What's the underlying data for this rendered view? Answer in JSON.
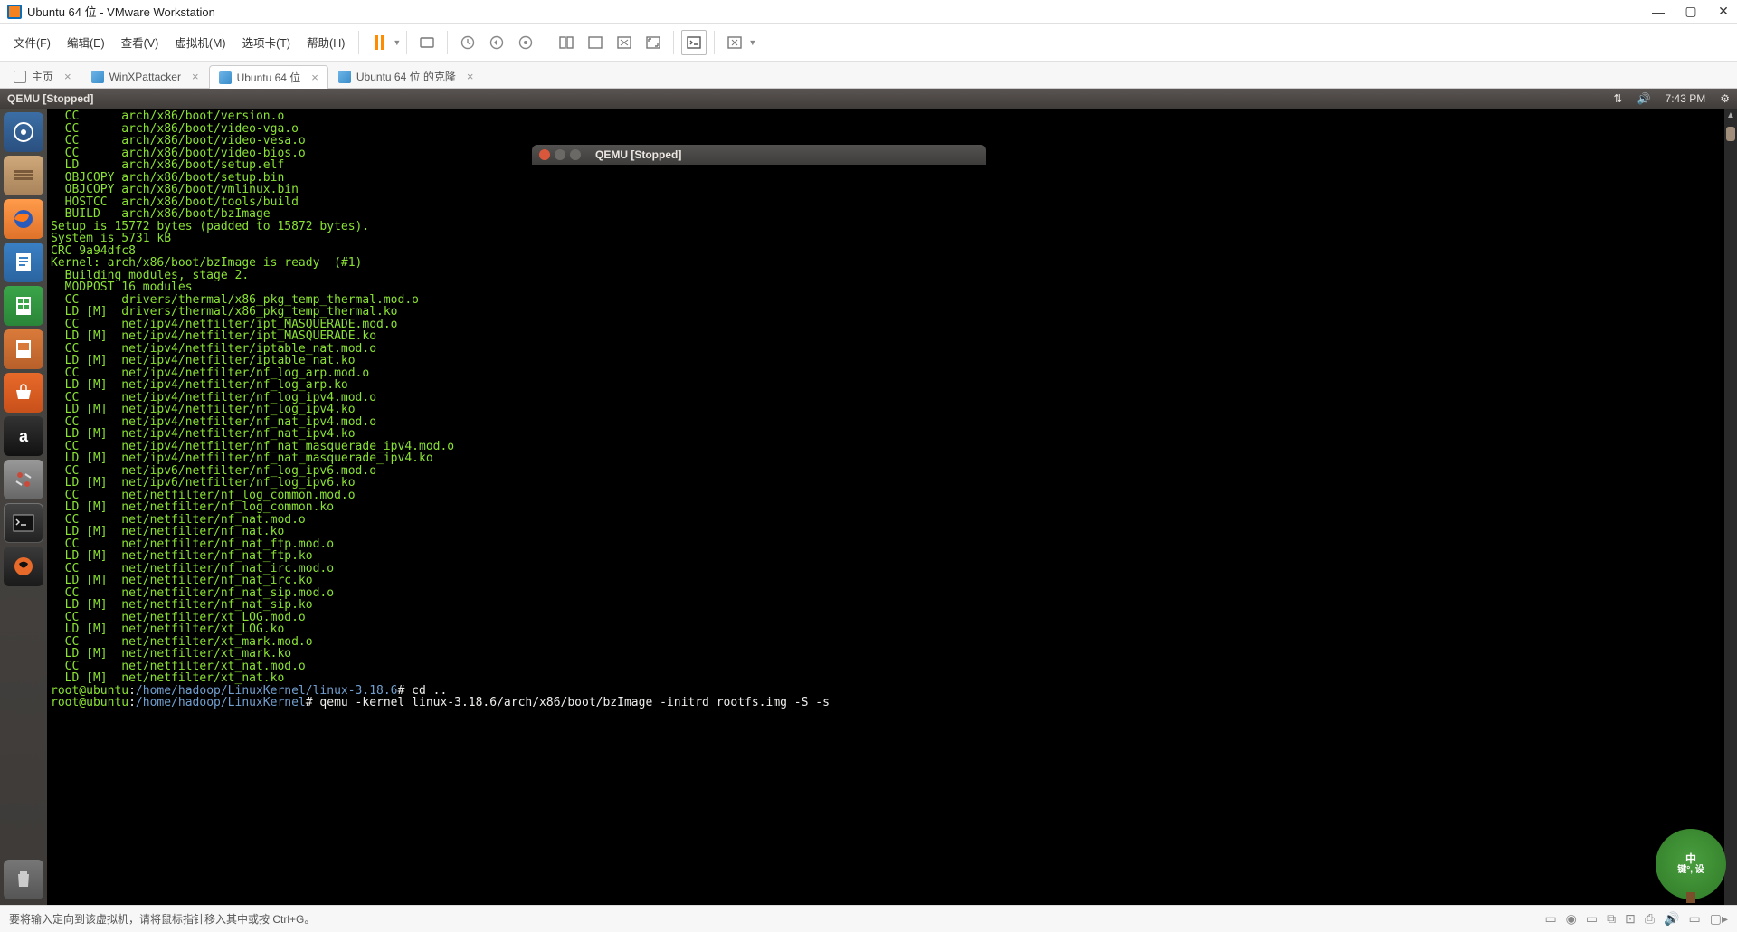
{
  "window": {
    "title": "Ubuntu 64 位 - VMware Workstation"
  },
  "menubar": {
    "items": [
      "文件(F)",
      "编辑(E)",
      "查看(V)",
      "虚拟机(M)",
      "选项卡(T)",
      "帮助(H)"
    ]
  },
  "tabs": [
    {
      "label": "主页",
      "icon": "home",
      "active": false
    },
    {
      "label": "WinXPattacker",
      "icon": "machine",
      "active": false
    },
    {
      "label": "Ubuntu 64 位",
      "icon": "machine",
      "active": true
    },
    {
      "label": "Ubuntu 64 位 的克隆",
      "icon": "machine",
      "active": false
    }
  ],
  "ubuntu_top": {
    "title": "QEMU [Stopped]",
    "time": "7:43 PM"
  },
  "qemu_window": {
    "title": "QEMU [Stopped]"
  },
  "terminal": {
    "lines": [
      "  CC      arch/x86/boot/version.o",
      "  CC      arch/x86/boot/video-vga.o",
      "  CC      arch/x86/boot/video-vesa.o",
      "  CC      arch/x86/boot/video-bios.o",
      "  LD      arch/x86/boot/setup.elf",
      "  OBJCOPY arch/x86/boot/setup.bin",
      "  OBJCOPY arch/x86/boot/vmlinux.bin",
      "  HOSTCC  arch/x86/boot/tools/build",
      "  BUILD   arch/x86/boot/bzImage",
      "Setup is 15772 bytes (padded to 15872 bytes).",
      "System is 5731 kB",
      "CRC 9a94dfc8",
      "Kernel: arch/x86/boot/bzImage is ready  (#1)",
      "  Building modules, stage 2.",
      "  MODPOST 16 modules",
      "  CC      drivers/thermal/x86_pkg_temp_thermal.mod.o",
      "  LD [M]  drivers/thermal/x86_pkg_temp_thermal.ko",
      "  CC      net/ipv4/netfilter/ipt_MASQUERADE.mod.o",
      "  LD [M]  net/ipv4/netfilter/ipt_MASQUERADE.ko",
      "  CC      net/ipv4/netfilter/iptable_nat.mod.o",
      "  LD [M]  net/ipv4/netfilter/iptable_nat.ko",
      "  CC      net/ipv4/netfilter/nf_log_arp.mod.o",
      "  LD [M]  net/ipv4/netfilter/nf_log_arp.ko",
      "  CC      net/ipv4/netfilter/nf_log_ipv4.mod.o",
      "  LD [M]  net/ipv4/netfilter/nf_log_ipv4.ko",
      "  CC      net/ipv4/netfilter/nf_nat_ipv4.mod.o",
      "  LD [M]  net/ipv4/netfilter/nf_nat_ipv4.ko",
      "  CC      net/ipv4/netfilter/nf_nat_masquerade_ipv4.mod.o",
      "  LD [M]  net/ipv4/netfilter/nf_nat_masquerade_ipv4.ko",
      "  CC      net/ipv6/netfilter/nf_log_ipv6.mod.o",
      "  LD [M]  net/ipv6/netfilter/nf_log_ipv6.ko",
      "  CC      net/netfilter/nf_log_common.mod.o",
      "  LD [M]  net/netfilter/nf_log_common.ko",
      "  CC      net/netfilter/nf_nat.mod.o",
      "  LD [M]  net/netfilter/nf_nat.ko",
      "  CC      net/netfilter/nf_nat_ftp.mod.o",
      "  LD [M]  net/netfilter/nf_nat_ftp.ko",
      "  CC      net/netfilter/nf_nat_irc.mod.o",
      "  LD [M]  net/netfilter/nf_nat_irc.ko",
      "  CC      net/netfilter/nf_nat_sip.mod.o",
      "  LD [M]  net/netfilter/nf_nat_sip.ko",
      "  CC      net/netfilter/xt_LOG.mod.o",
      "  LD [M]  net/netfilter/xt_LOG.ko",
      "  CC      net/netfilter/xt_mark.mod.o",
      "  LD [M]  net/netfilter/xt_mark.ko",
      "  CC      net/netfilter/xt_nat.mod.o",
      "  LD [M]  net/netfilter/xt_nat.ko"
    ],
    "prompts": [
      {
        "user": "root@ubuntu",
        "path": "/home/hadoop/LinuxKernel/linux-3.18.6",
        "cmd": "cd .."
      },
      {
        "user": "root@ubuntu",
        "path": "/home/hadoop/LinuxKernel",
        "cmd": "qemu -kernel linux-3.18.6/arch/x86/boot/bzImage -initrd rootfs.img -S -s"
      }
    ]
  },
  "statusbar": {
    "text": "要将输入定向到该虚拟机，请将鼠标指针移入其中或按 Ctrl+G。"
  },
  "tree_badge": {
    "line1": "中",
    "line2": "键°, 设"
  }
}
